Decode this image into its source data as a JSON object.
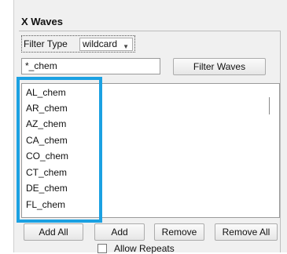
{
  "panel": {
    "title": "X Waves"
  },
  "filter": {
    "type_label": "Filter Type",
    "type_value": "wildcard",
    "input_value": "*_chem",
    "button_label": "Filter Waves"
  },
  "list": {
    "items": [
      "AL_chem",
      "AR_chem",
      "AZ_chem",
      "CA_chem",
      "CO_chem",
      "CT_chem",
      "DE_chem",
      "FL_chem"
    ]
  },
  "buttons": {
    "add_all": "Add All",
    "add": "Add",
    "remove": "Remove",
    "remove_all": "Remove All"
  },
  "allow_repeats": {
    "label": "Allow Repeats",
    "checked": false
  },
  "colors": {
    "highlight": "#1ba1e2"
  }
}
